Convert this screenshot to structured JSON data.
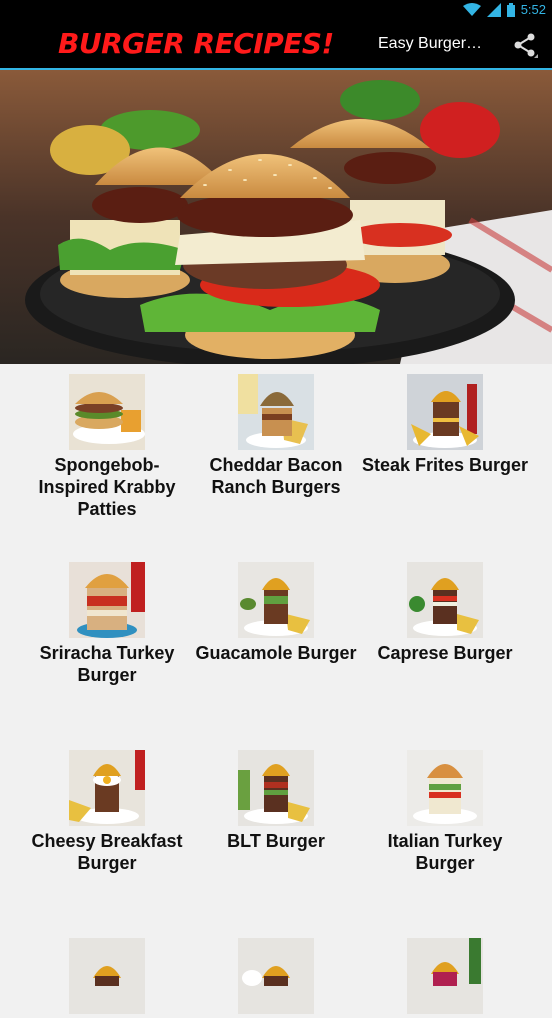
{
  "status_bar": {
    "time": "5:52",
    "icons": [
      "wifi-icon",
      "signal-icon",
      "battery-icon"
    ]
  },
  "action_bar": {
    "app_title": "BURGER RECIPES!",
    "subtitle": "Easy Burger…",
    "share_icon": "share-icon"
  },
  "recipes": [
    {
      "label": "Spongebob-Inspired Krabby Patties"
    },
    {
      "label": "Cheddar Bacon Ranch Burgers"
    },
    {
      "label": "Steak Frites Burger"
    },
    {
      "label": "Sriracha Turkey Burger"
    },
    {
      "label": "Guacamole Burger"
    },
    {
      "label": "Caprese Burger"
    },
    {
      "label": "Cheesy Breakfast Burger"
    },
    {
      "label": "BLT Burger"
    },
    {
      "label": "Italian Turkey Burger"
    },
    {
      "label": ""
    },
    {
      "label": ""
    },
    {
      "label": ""
    }
  ],
  "colors": {
    "accent": "#33b5e5",
    "title_red": "#ff1a1a",
    "bar_bg": "#000000",
    "page_bg": "#f1f1f1"
  }
}
